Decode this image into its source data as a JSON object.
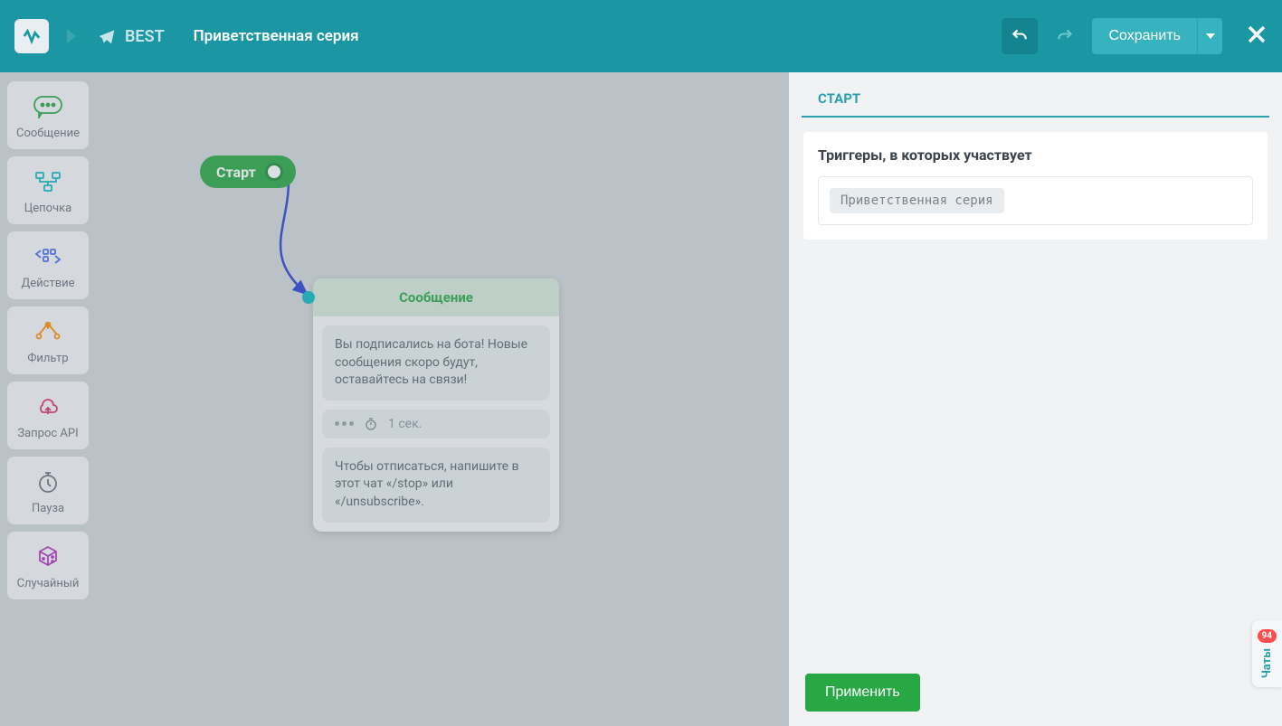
{
  "header": {
    "bot_name": "BEST",
    "series_title": "Приветственная серия",
    "save_label": "Сохранить"
  },
  "toolbox": {
    "items": [
      {
        "label": "Сообщение"
      },
      {
        "label": "Цепочка"
      },
      {
        "label": "Действие"
      },
      {
        "label": "Фильтр"
      },
      {
        "label": "Запрос API"
      },
      {
        "label": "Пауза"
      },
      {
        "label": "Случайный"
      }
    ]
  },
  "canvas": {
    "start_label": "Старт",
    "message_node": {
      "title": "Сообщение",
      "block1": "Вы подписались на бота! Новые сообщения скоро будут, оставайтесь на связи!",
      "timing": "1 сек.",
      "block2": "Чтобы отписаться, напишите в этот чат «/stop» или «/unsubscribe»."
    }
  },
  "panel": {
    "title": "СТАРТ",
    "section_title": "Триггеры, в которых участвует",
    "trigger": "Приветственная серия",
    "apply_label": "Применить"
  },
  "chat_tab": {
    "badge": "94",
    "label": "Чаты"
  },
  "colors": {
    "primary": "#1a97a3",
    "accent": "#28a745"
  }
}
